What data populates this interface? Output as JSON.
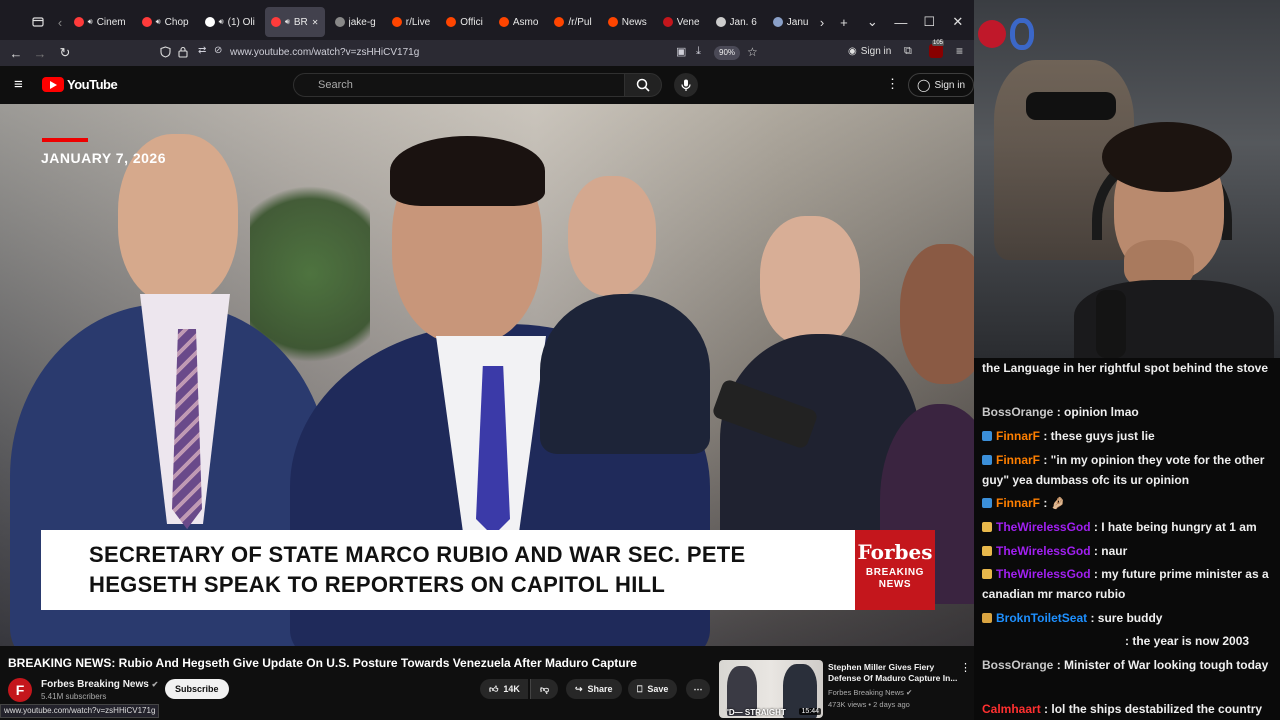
{
  "browser": {
    "tabs": [
      {
        "label": "Cinem",
        "color": "#ff3b3b"
      },
      {
        "label": "Chop",
        "color": "#ff3b3b"
      },
      {
        "label": "(1) Oli",
        "color": "#ffffff"
      },
      {
        "label": "BR",
        "color": "#ff3b3b"
      },
      {
        "label": "jake-g",
        "color": "#888888"
      },
      {
        "label": "r/Live",
        "color": "#ff4500"
      },
      {
        "label": "Offici",
        "color": "#ff4500"
      },
      {
        "label": "Asmo",
        "color": "#ff4500"
      },
      {
        "label": "/r/Pul",
        "color": "#ff4500"
      },
      {
        "label": "News",
        "color": "#ff4500"
      },
      {
        "label": "Vene",
        "color": "#c4161c"
      },
      {
        "label": "Jan. 6",
        "color": "#cccccc"
      },
      {
        "label": "Janu",
        "color": "#8aa0c8"
      }
    ],
    "url": "www.youtube.com/watch?v=zsHHiCV171g",
    "zoom": "90%",
    "signin_label": "Sign in",
    "ext_badge": "105"
  },
  "youtube": {
    "logo_text": "YouTube",
    "search_placeholder": "Search",
    "signin_label": "Sign in"
  },
  "video": {
    "date_text": "JANUARY 7, 2026",
    "lower_third": "SECRETARY OF STATE MARCO RUBIO AND WAR SEC. PETE HEGSETH SPEAK TO REPORTERS ON CAPITOL HILL",
    "forbes_logo": "Forbes",
    "forbes_sub": "BREAKING NEWS",
    "title": "BREAKING NEWS: Rubio And Hegseth Give Update On U.S. Posture Towards Venezuela After Maduro Capture",
    "channel_initial": "F",
    "channel_name": "Forbes Breaking News",
    "subscribers": "5.41M subscribers",
    "subscribe_label": "Subscribe",
    "likes": "14K",
    "share_label": "Share",
    "save_label": "Save"
  },
  "recommended": {
    "title": "Stephen Miller Gives Fiery Defense Of Maduro Capture In...",
    "channel": "Forbes Breaking News",
    "meta": "473K views • 2 days ago",
    "duration": "15:44",
    "thumb_caption": "'D— STRAIGHT"
  },
  "statusbar_url": "www.youtube.com/watch?v=zsHHiCV171g",
  "chat": [
    {
      "user": "",
      "user_color": "#efefef",
      "badge": "",
      "text": "the Language in her rightful spot behind the stove"
    },
    {
      "user": "BossOrange",
      "user_color": "#c8c8c8",
      "badge": "",
      "text": "opinion lmao"
    },
    {
      "user": "FinnarF",
      "user_color": "#ff7f00",
      "badge": "#3b8fd9",
      "text": "these guys just lie"
    },
    {
      "user": "FinnarF",
      "user_color": "#ff7f00",
      "badge": "#3b8fd9",
      "text": "\"in my opinion they vote for the other guy\" yea dumbass ofc its ur opinion"
    },
    {
      "user": "FinnarF",
      "user_color": "#ff7f00",
      "badge": "#3b8fd9",
      "text": "🤌🏼"
    },
    {
      "user": "TheWirelessGod",
      "user_color": "#a020f0",
      "badge": "#e8b84b",
      "text": "I hate being hungry at 1 am"
    },
    {
      "user": "TheWirelessGod",
      "user_color": "#a020f0",
      "badge": "#e8b84b",
      "text": "naur"
    },
    {
      "user": "TheWirelessGod",
      "user_color": "#a020f0",
      "badge": "#e8b84b",
      "text": "my future prime minister as a canadian mr marco rubio"
    },
    {
      "user": "BroknToiletSeat",
      "user_color": "#1e90ff",
      "badge": "#d9a441",
      "text": "sure buddy"
    },
    {
      "user": "",
      "user_color": "#efefef",
      "badge": "",
      "text": "the year is now 2003"
    },
    {
      "user": "BossOrange",
      "user_color": "#c8c8c8",
      "badge": "",
      "text": "Minister of War looking tough today"
    },
    {
      "user": "Calmhaart",
      "user_color": "#ff3030",
      "badge": "",
      "text": "lol the ships destabilized the country"
    }
  ],
  "colors": {
    "yt_red": "#ff0000",
    "forbes_red": "#c4161c",
    "tab_active": "#42414d"
  }
}
